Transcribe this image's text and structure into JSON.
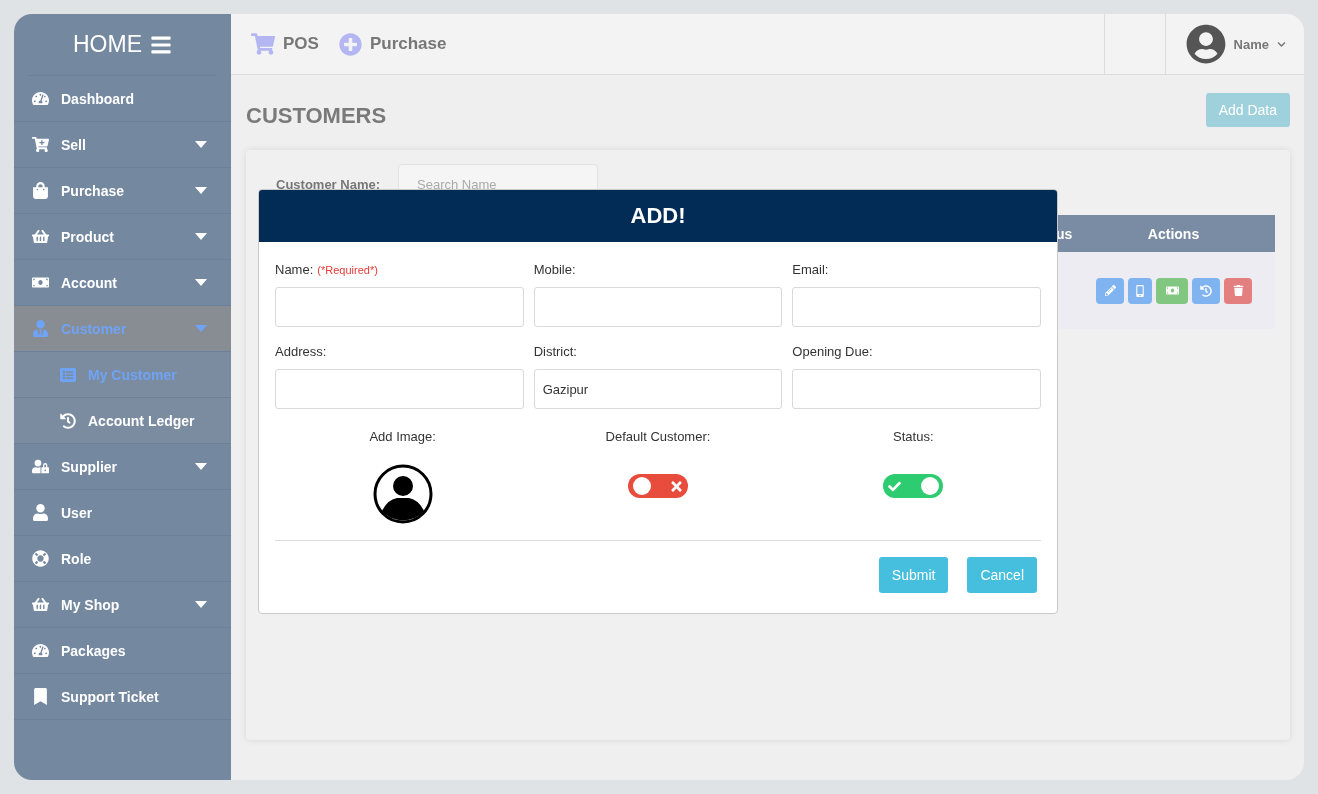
{
  "sidebar": {
    "title": "HOME",
    "items": [
      {
        "label": "Dashboard",
        "dropdown": false,
        "selected": false
      },
      {
        "label": "Sell",
        "dropdown": true,
        "selected": false
      },
      {
        "label": "Purchase",
        "dropdown": true,
        "selected": false
      },
      {
        "label": "Product",
        "dropdown": true,
        "selected": false
      },
      {
        "label": "Account",
        "dropdown": true,
        "selected": false
      },
      {
        "label": "Customer",
        "dropdown": true,
        "selected": true,
        "children": [
          {
            "label": "My Customer",
            "selected": true
          },
          {
            "label": "Account Ledger",
            "selected": false
          }
        ]
      },
      {
        "label": "Supplier",
        "dropdown": true,
        "selected": false
      },
      {
        "label": "User",
        "dropdown": false,
        "selected": false
      },
      {
        "label": "Role",
        "dropdown": false,
        "selected": false
      },
      {
        "label": "My Shop",
        "dropdown": true,
        "selected": false
      },
      {
        "label": "Packages",
        "dropdown": false,
        "selected": false
      },
      {
        "label": "Support Ticket",
        "dropdown": false,
        "selected": false
      }
    ]
  },
  "topbar": {
    "links": [
      "POS",
      "Purchase"
    ],
    "user": "Name"
  },
  "page": {
    "title": "CUSTOMERS",
    "add_button": "Add Data"
  },
  "filter": {
    "label": "Customer Name:",
    "placeholder": "Search Name"
  },
  "table": {
    "columns": [
      "us",
      "Actions"
    ]
  },
  "modal": {
    "title": "ADD!",
    "fields": [
      {
        "label": "Name:",
        "required_note": "(*Required*)"
      },
      {
        "label": "Mobile:"
      },
      {
        "label": "Email:"
      },
      {
        "label": "Address:"
      },
      {
        "label": "District:",
        "value": "Gazipur"
      },
      {
        "label": "Opening Due:"
      }
    ],
    "image_label": "Add Image:",
    "toggles": [
      {
        "label": "Default Customer:",
        "on": false
      },
      {
        "label": "Status:",
        "on": true
      }
    ],
    "buttons": [
      "Submit",
      "Cancel"
    ]
  }
}
